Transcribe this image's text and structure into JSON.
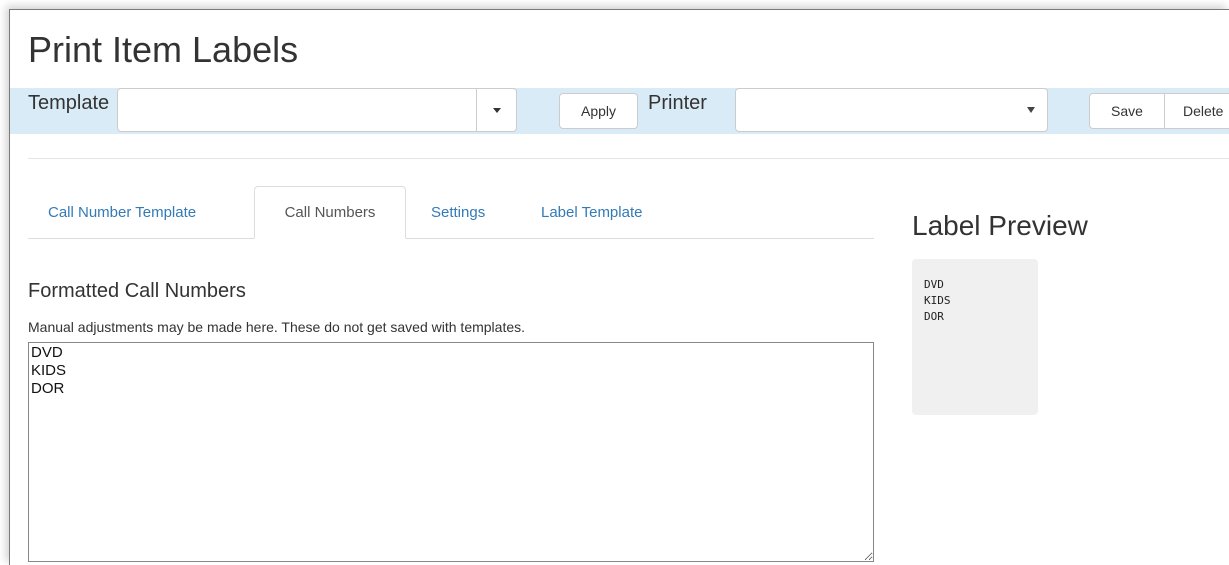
{
  "page": {
    "title": "Print Item Labels"
  },
  "toolbar": {
    "template_label": "Template",
    "template_value": "",
    "apply_label": "Apply",
    "printer_label": "Printer",
    "printer_value": "",
    "save_label": "Save",
    "delete_label": "Delete"
  },
  "tabs": [
    {
      "label": "Call Number Template",
      "active": false
    },
    {
      "label": "Call Numbers",
      "active": true
    },
    {
      "label": "Settings",
      "active": false
    },
    {
      "label": "Label Template",
      "active": false
    }
  ],
  "call_numbers": {
    "heading": "Formatted Call Numbers",
    "help_text": "Manual adjustments may be made here. These do not get saved with templates.",
    "value": "DVD\nKIDS\nDOR"
  },
  "preview": {
    "heading": "Label Preview",
    "lines": [
      "DVD",
      "KIDS",
      "DOR"
    ]
  },
  "colors": {
    "toolbar_bg": "#d9ebf6",
    "link": "#337ab7",
    "preview_bg": "#f0f0f0"
  },
  "icons": {
    "template_toggle": "caret-down-icon",
    "printer_toggle": "select-arrow-icon",
    "textarea_resize": "resize-grip-icon"
  }
}
